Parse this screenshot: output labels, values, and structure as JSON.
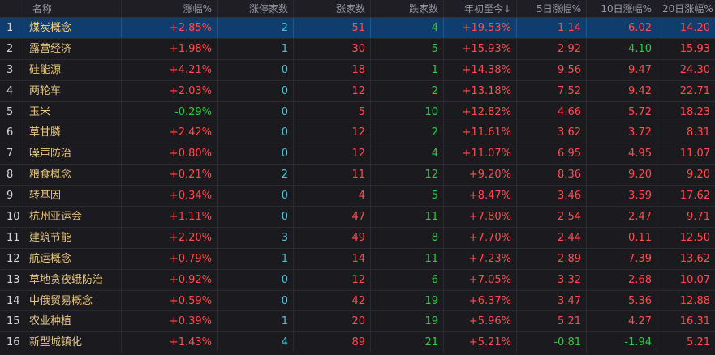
{
  "headers": [
    "",
    "名称",
    "涨幅%",
    "涨停家数",
    "涨家数",
    "跌家数",
    "年初至今↓",
    "5日涨幅%",
    "10日涨幅%",
    "20日涨幅%"
  ],
  "colors": {
    "up": "#ff4d4d",
    "down": "#2ecc40",
    "neutral": "#4fc3d9",
    "name": "#e8c882",
    "selected_row": "#0e3d6e"
  },
  "rows": [
    {
      "idx": "1",
      "name": "煤炭概念",
      "change": "+2.85%",
      "limit_up": "2",
      "up": "51",
      "down": "4",
      "ytd": "+19.53%",
      "d5": "1.14",
      "d10": "6.02",
      "d20": "14.20",
      "selected": true
    },
    {
      "idx": "2",
      "name": "露营经济",
      "change": "+1.98%",
      "limit_up": "1",
      "up": "30",
      "down": "5",
      "ytd": "+15.93%",
      "d5": "2.92",
      "d10": "-4.10",
      "d20": "15.93"
    },
    {
      "idx": "3",
      "name": "硅能源",
      "change": "+4.21%",
      "limit_up": "0",
      "up": "18",
      "down": "1",
      "ytd": "+14.38%",
      "d5": "9.56",
      "d10": "9.47",
      "d20": "24.30"
    },
    {
      "idx": "4",
      "name": "两轮车",
      "change": "+2.03%",
      "limit_up": "0",
      "up": "12",
      "down": "2",
      "ytd": "+13.18%",
      "d5": "7.52",
      "d10": "9.42",
      "d20": "22.71"
    },
    {
      "idx": "5",
      "name": "玉米",
      "change": "-0.29%",
      "limit_up": "0",
      "up": "5",
      "down": "10",
      "ytd": "+12.82%",
      "d5": "4.66",
      "d10": "5.72",
      "d20": "18.23"
    },
    {
      "idx": "6",
      "name": "草甘膦",
      "change": "+2.42%",
      "limit_up": "0",
      "up": "12",
      "down": "2",
      "ytd": "+11.61%",
      "d5": "3.62",
      "d10": "3.72",
      "d20": "8.31"
    },
    {
      "idx": "7",
      "name": "噪声防治",
      "change": "+0.80%",
      "limit_up": "0",
      "up": "12",
      "down": "4",
      "ytd": "+11.07%",
      "d5": "6.95",
      "d10": "4.95",
      "d20": "11.07"
    },
    {
      "idx": "8",
      "name": "粮食概念",
      "change": "+0.21%",
      "limit_up": "2",
      "up": "11",
      "down": "12",
      "ytd": "+9.20%",
      "d5": "8.36",
      "d10": "9.20",
      "d20": "9.20"
    },
    {
      "idx": "9",
      "name": "转基因",
      "change": "+0.34%",
      "limit_up": "0",
      "up": "4",
      "down": "5",
      "ytd": "+8.47%",
      "d5": "3.46",
      "d10": "3.59",
      "d20": "17.62"
    },
    {
      "idx": "10",
      "name": "杭州亚运会",
      "change": "+1.11%",
      "limit_up": "0",
      "up": "47",
      "down": "11",
      "ytd": "+7.80%",
      "d5": "2.54",
      "d10": "2.47",
      "d20": "9.71"
    },
    {
      "idx": "11",
      "name": "建筑节能",
      "change": "+2.20%",
      "limit_up": "3",
      "up": "49",
      "down": "8",
      "ytd": "+7.70%",
      "d5": "2.44",
      "d10": "0.11",
      "d20": "12.50"
    },
    {
      "idx": "12",
      "name": "航运概念",
      "change": "+0.79%",
      "limit_up": "1",
      "up": "14",
      "down": "11",
      "ytd": "+7.23%",
      "d5": "2.89",
      "d10": "7.39",
      "d20": "13.62"
    },
    {
      "idx": "13",
      "name": "草地贪夜蛾防治",
      "change": "+0.92%",
      "limit_up": "0",
      "up": "12",
      "down": "6",
      "ytd": "+7.05%",
      "d5": "3.32",
      "d10": "2.68",
      "d20": "10.07"
    },
    {
      "idx": "14",
      "name": "中俄贸易概念",
      "change": "+0.59%",
      "limit_up": "0",
      "up": "42",
      "down": "19",
      "ytd": "+6.37%",
      "d5": "3.47",
      "d10": "5.36",
      "d20": "12.88"
    },
    {
      "idx": "15",
      "name": "农业种植",
      "change": "+0.39%",
      "limit_up": "1",
      "up": "20",
      "down": "19",
      "ytd": "+5.96%",
      "d5": "5.21",
      "d10": "4.27",
      "d20": "16.31"
    },
    {
      "idx": "16",
      "name": "新型城镇化",
      "change": "+1.43%",
      "limit_up": "4",
      "up": "89",
      "down": "21",
      "ytd": "+5.21%",
      "d5": "-0.81",
      "d10": "-1.94",
      "d20": "5.21"
    }
  ]
}
